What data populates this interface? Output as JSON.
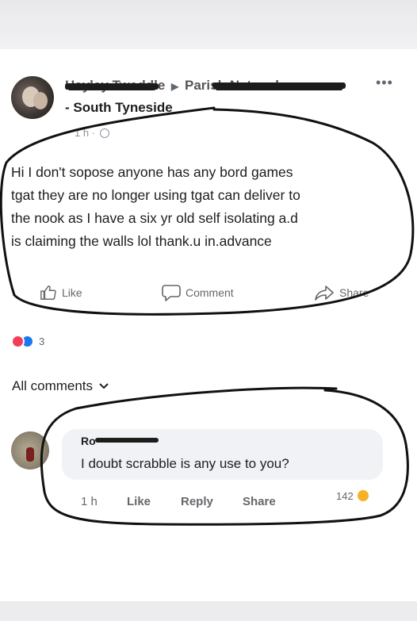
{
  "post": {
    "author_name": "Hayley Tweddle",
    "arrow": "▶",
    "group_name_obscured": "Parish Network",
    "group_line": "- South Tyneside",
    "more_menu": "•••",
    "timestamp": "1 h ·",
    "text_lines": [
      "Hi I don't sopose anyone has any bord games",
      "tgat they are no longer using tgat can deliver to",
      "the nook as I have a six yr old self isolating a.d",
      "is claiming the walls lol  thank.u in.advance"
    ],
    "actions": {
      "like": "Like",
      "comment": "Comment",
      "share": "Share"
    },
    "reaction_count": "3"
  },
  "comments_filter": {
    "label": "All comments"
  },
  "comment": {
    "author_name": "Ro",
    "text": "I doubt scrabble is any use to you?",
    "time": "1 h",
    "like": "Like",
    "reply": "Reply",
    "share": "Share",
    "reaction_count": "142"
  },
  "colors": {
    "accent_blue": "#1877f2",
    "love_red": "#f33e58",
    "pen_ink": "#111111"
  }
}
